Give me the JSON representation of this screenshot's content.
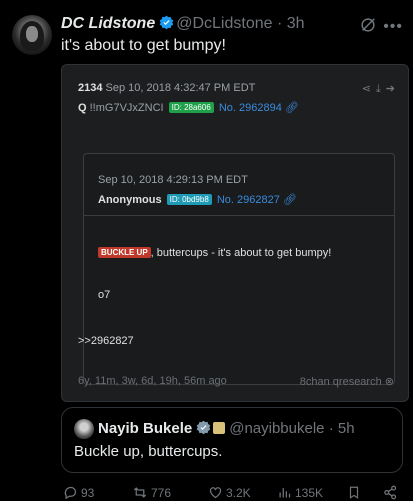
{
  "tweet": {
    "author_name": "DC Lidstone",
    "author_handle": "@DcLidstone",
    "separator": "·",
    "time": "3h",
    "text": "it's about to get bumpy!"
  },
  "post": {
    "number": "2134",
    "date": "Sep 10, 2018 4:32:47 PM EDT",
    "q_label": "Q",
    "tripcode": "!!mG7VJxZNCI",
    "id_badge": "ID: 28a606",
    "post_no": "No. 2962894",
    "reply_ref": ">>2962827",
    "age": "6y, 11m, 3w, 6d, 19h, 56m ago",
    "source": "8chan qresearch",
    "quoted": {
      "date": "Sep 10, 2018 4:29:13 PM EDT",
      "author": "Anonymous",
      "id_badge": "ID: 0bd9b8",
      "post_no": "No. 2962827",
      "badge": "BUCKLE UP",
      "text": ", buttercups - it's about to get bumpy!",
      "signoff": "o7"
    }
  },
  "quote_tweet": {
    "name": "Nayib Bukele",
    "handle": "@nayibbukele",
    "separator": "·",
    "time": "5h",
    "text": "Buckle up, buttercups."
  },
  "actions": {
    "replies": "93",
    "reposts": "776",
    "likes": "3.2K",
    "views": "135K"
  },
  "colors": {
    "background": "#000000",
    "verified": "#1d9bf0",
    "link": "#3a8bdc",
    "id_badge": "#1fa14a",
    "red_badge": "#c0392b"
  }
}
